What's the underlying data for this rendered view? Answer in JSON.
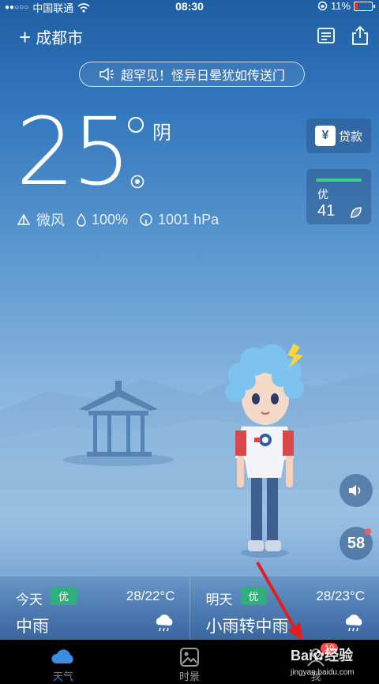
{
  "status_bar": {
    "carrier": "中国联通",
    "time": "08:30",
    "battery": "11%"
  },
  "header": {
    "city": "成都市"
  },
  "notice": {
    "text": "超罕见！怪异日晕犹如传送门"
  },
  "current": {
    "temperature": "25",
    "condition": "阴",
    "wind": "微风",
    "humidity": "100%",
    "pressure": "1001 hPa"
  },
  "side_cards": {
    "loan_label": "贷款",
    "loan_icon_char": "¥",
    "aqi_level": "优",
    "aqi_value": "41"
  },
  "message_count": "58",
  "forecast": [
    {
      "day": "今天",
      "quality": "优",
      "range": "28/22°C",
      "desc": "中雨"
    },
    {
      "day": "明天",
      "quality": "优",
      "range": "28/23°C",
      "desc": "小雨转中雨"
    }
  ],
  "tabs": [
    {
      "label": "天气"
    },
    {
      "label": "时景"
    },
    {
      "label": "我",
      "badge": "10"
    }
  ],
  "watermark": {
    "brand": "Bai",
    "brand2": "经验",
    "url": "jingyan.baidu.com"
  },
  "colors": {
    "active_tab": "#3a8de0",
    "quality_badge": "#2fb07a",
    "aqi_bar": "#3ad08a",
    "red_arrow": "#e02020"
  }
}
